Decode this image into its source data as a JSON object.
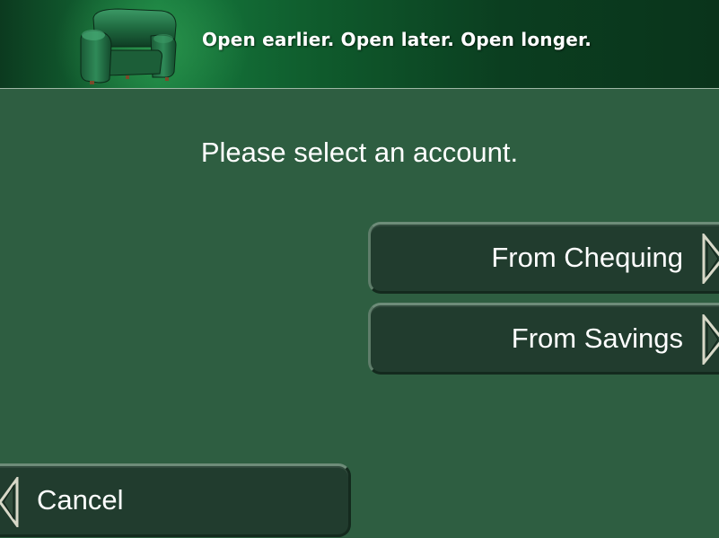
{
  "banner": {
    "tagline": "Open earlier. Open later. Open longer.",
    "image": "armchair-icon"
  },
  "prompt": "Please select an account.",
  "options": [
    {
      "label": "From Chequing",
      "icon": "chevron-right-icon"
    },
    {
      "label": "From Savings",
      "icon": "chevron-right-icon"
    }
  ],
  "cancel": {
    "label": "Cancel",
    "icon": "chevron-left-icon"
  },
  "colors": {
    "background": "#2e5e41",
    "button": "#213c2e",
    "banner": "#0f5a2c",
    "text": "#ffffff"
  }
}
